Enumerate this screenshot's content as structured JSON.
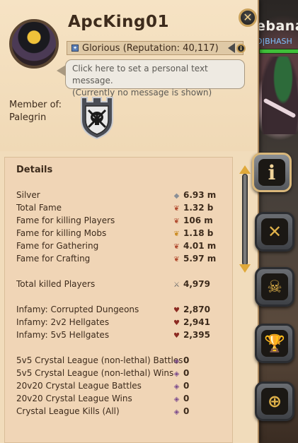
{
  "world": {
    "player_name_partial": "ebana",
    "guild_tag_partial": "D|BHASH"
  },
  "profile": {
    "name": "ApcKing01",
    "close_symbol": "✕",
    "reputation_text": "Glorious (Reputation: 40,117)",
    "message_line1": "Click here to set a personal text message.",
    "message_line2": "(Currently no message is shown)",
    "member_of_label": "Member of:",
    "guild_name": "Palegrin"
  },
  "details": {
    "title": "Details",
    "stats": [
      {
        "label": "Silver",
        "value": "6.93 m",
        "icon": "silver-icon"
      },
      {
        "label": "Total Fame",
        "value": "1.32 b",
        "icon": "fame-icon"
      },
      {
        "label": "Fame for killing Players",
        "value": "106 m",
        "icon": "pvp-fame-icon"
      },
      {
        "label": "Fame for killing Mobs",
        "value": "1.18 b",
        "icon": "pve-fame-icon"
      },
      {
        "label": "Fame for Gathering",
        "value": "4.01 m",
        "icon": "gathering-fame-icon"
      },
      {
        "label": "Fame for Crafting",
        "value": "5.97 m",
        "icon": "crafting-fame-icon"
      },
      {
        "label": "Total killed Players",
        "value": "4,979",
        "icon": "crossed-swords-icon"
      },
      {
        "label": "Infamy: Corrupted Dungeons",
        "value": "2,870",
        "icon": "infamy-icon"
      },
      {
        "label": "Infamy: 2v2 Hellgates",
        "value": "2,941",
        "icon": "infamy-icon"
      },
      {
        "label": "Infamy: 5v5 Hellgates",
        "value": "2,395",
        "icon": "infamy-icon"
      },
      {
        "label": "5v5 Crystal League (non-lethal) Battles",
        "value": "0",
        "icon": "crystal-icon"
      },
      {
        "label": "5v5 Crystal League (non-lethal) Wins",
        "value": "0",
        "icon": "crystal-icon"
      },
      {
        "label": "20v20 Crystal League Battles",
        "value": "0",
        "icon": "crystal-icon"
      },
      {
        "label": "20v20 Crystal League Wins",
        "value": "0",
        "icon": "crystal-icon"
      },
      {
        "label": "Crystal League Kills (All)",
        "value": "0",
        "icon": "crystal-icon"
      }
    ]
  },
  "tabs": [
    {
      "name": "tab-info",
      "icon": "info-icon",
      "glyph": "i"
    },
    {
      "name": "tab-combat",
      "icon": "crossed-swords-icon",
      "glyph": "✕"
    },
    {
      "name": "tab-kills",
      "icon": "skull-icon",
      "glyph": "☠"
    },
    {
      "name": "tab-achievements",
      "icon": "trophy-icon",
      "glyph": "🏆"
    },
    {
      "name": "tab-guild-warfare",
      "icon": "globe-swords-icon",
      "glyph": "⊕"
    }
  ],
  "colors": {
    "parchment": "#f1dcbb",
    "details_bg": "#f0d5b6",
    "text_dark": "#3d2b1c",
    "accent_gold": "#c9a15b",
    "scroll_arrow": "#e0a93a"
  }
}
